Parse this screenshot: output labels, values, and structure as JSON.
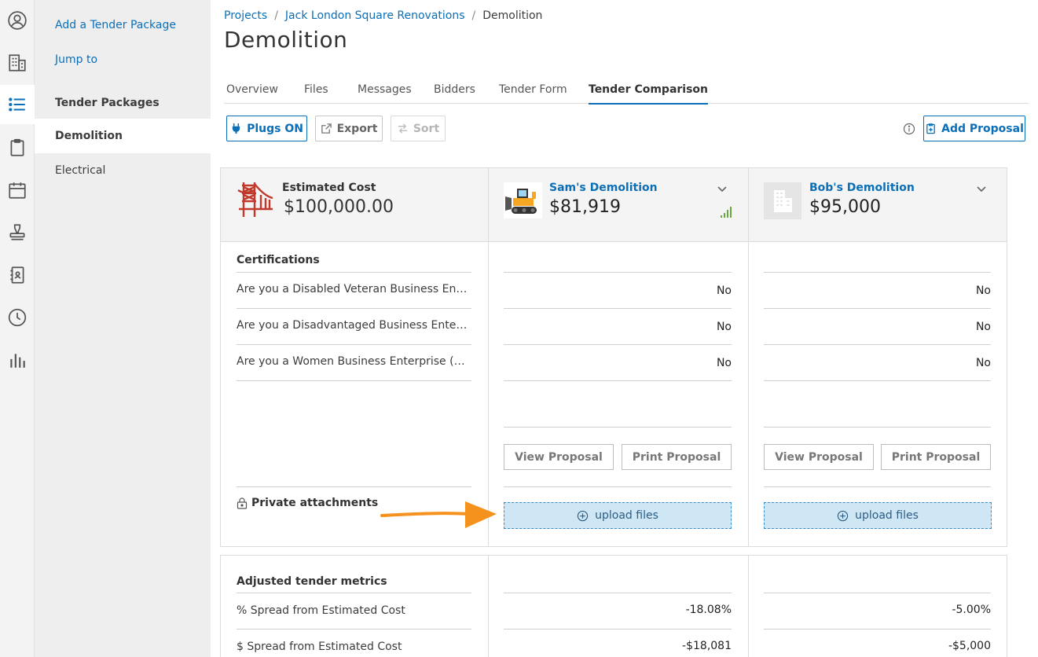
{
  "rail": {
    "icons": [
      "user-circle-icon",
      "building-icon",
      "list-icon",
      "clipboard-icon",
      "calendar-icon",
      "stamp-icon",
      "contacts-book-icon",
      "clock-icon",
      "bar-chart-icon"
    ],
    "active_icon": "list-icon"
  },
  "subnav": {
    "add_package": "Add a Tender Package",
    "jump_to": "Jump to",
    "header": "Tender Packages",
    "items": [
      "Demolition",
      "Electrical"
    ],
    "selected": "Demolition"
  },
  "breadcrumb": {
    "projects": "Projects",
    "project": "Jack London Square Renovations",
    "current": "Demolition",
    "separator": "/"
  },
  "page_title": "Demolition",
  "tabs": [
    "Overview",
    "Files",
    "Messages",
    "Bidders",
    "Tender Form",
    "Tender Comparison"
  ],
  "active_tab": "Tender Comparison",
  "toolbar": {
    "plugs": "Plugs ON",
    "export": "Export",
    "sort": "Sort",
    "add_proposal": "Add Proposal"
  },
  "estimate": {
    "label": "Estimated Cost",
    "value": "$100,000.00"
  },
  "bidders": [
    {
      "name": "Sam's Demolition",
      "amount": "$81,919",
      "logo": "bulldozer-logo",
      "answers": [
        "No",
        "No",
        "No"
      ],
      "view": "View Proposal",
      "print": "Print Proposal",
      "upload": "upload files",
      "pct_spread": "-18.08%",
      "dollar_spread": "-$18,081"
    },
    {
      "name": "Bob's Demolition",
      "amount": "$95,000",
      "logo": "building-placeholder-logo",
      "answers": [
        "No",
        "No",
        "No"
      ],
      "view": "View Proposal",
      "print": "Print Proposal",
      "upload": "upload files",
      "pct_spread": "-5.00%",
      "dollar_spread": "-$5,000"
    }
  ],
  "certifications": {
    "title": "Certifications",
    "questions": [
      "Are you a Disabled Veteran Business Enterprise (DVBE)?",
      "Are you a Disadvantaged Business Enterprise (DBE)?",
      "Are you a Women Business Enterprise (WBE)?"
    ]
  },
  "private_attachments": "Private attachments",
  "metrics": {
    "title": "Adjusted tender metrics",
    "rows": [
      "% Spread from Estimated Cost",
      "$ Spread from Estimated Cost"
    ]
  },
  "colors": {
    "accent": "#0b6fb8",
    "upload_bg": "#cfe7f5",
    "arrow": "#f5921e",
    "signal": "#5a9e2f",
    "brand_red": "#c0392b"
  }
}
